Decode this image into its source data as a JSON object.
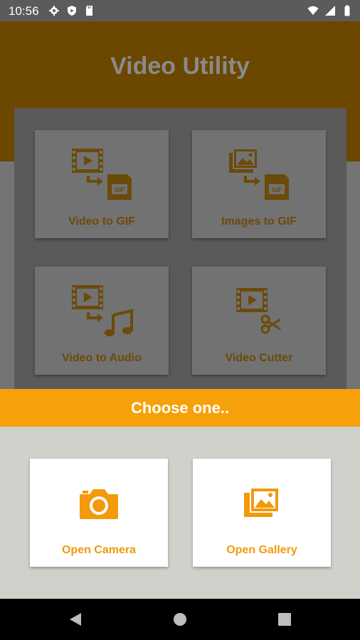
{
  "status_bar": {
    "time": "10:56"
  },
  "app": {
    "title": "Video Utility"
  },
  "tiles": [
    {
      "label": "Video to GIF"
    },
    {
      "label": "Images to GIF"
    },
    {
      "label": "Video to Audio"
    },
    {
      "label": "Video Cutter"
    }
  ],
  "dialog": {
    "title": "Choose one..",
    "options": [
      {
        "label": "Open Camera",
        "icon": "camera-icon"
      },
      {
        "label": "Open Gallery",
        "icon": "gallery-icon"
      }
    ]
  },
  "colors": {
    "accent": "#f6a00a",
    "header_dimmed": "#6b4700",
    "tile_label_dimmed": "#6b4a0a",
    "sheet_bg": "#cfd2cb"
  }
}
